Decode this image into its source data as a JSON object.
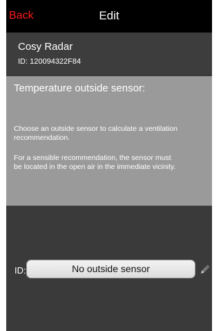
{
  "navbar": {
    "back_label": "Back",
    "title": "Edit"
  },
  "device": {
    "name": "Cosy Radar",
    "id": "ID: 120094322F84"
  },
  "info": {
    "heading": "Temperature outside sensor:",
    "paragraph1": [
      "Choose an outside sensor to calculate a ventilation",
      "recommendation."
    ],
    "paragraph2": [
      "For a sensible recommendation, the sensor must",
      "be located in the open air in the immediate vicinity."
    ]
  },
  "sensor": {
    "id_label": "ID:",
    "selected": "No outside sensor",
    "edit_icon": "pencil-icon"
  },
  "colors": {
    "back": "#ff1a1a",
    "navbar": "#000000",
    "screen": "#3a3a3a",
    "info_panel": "#9a9a9a"
  }
}
